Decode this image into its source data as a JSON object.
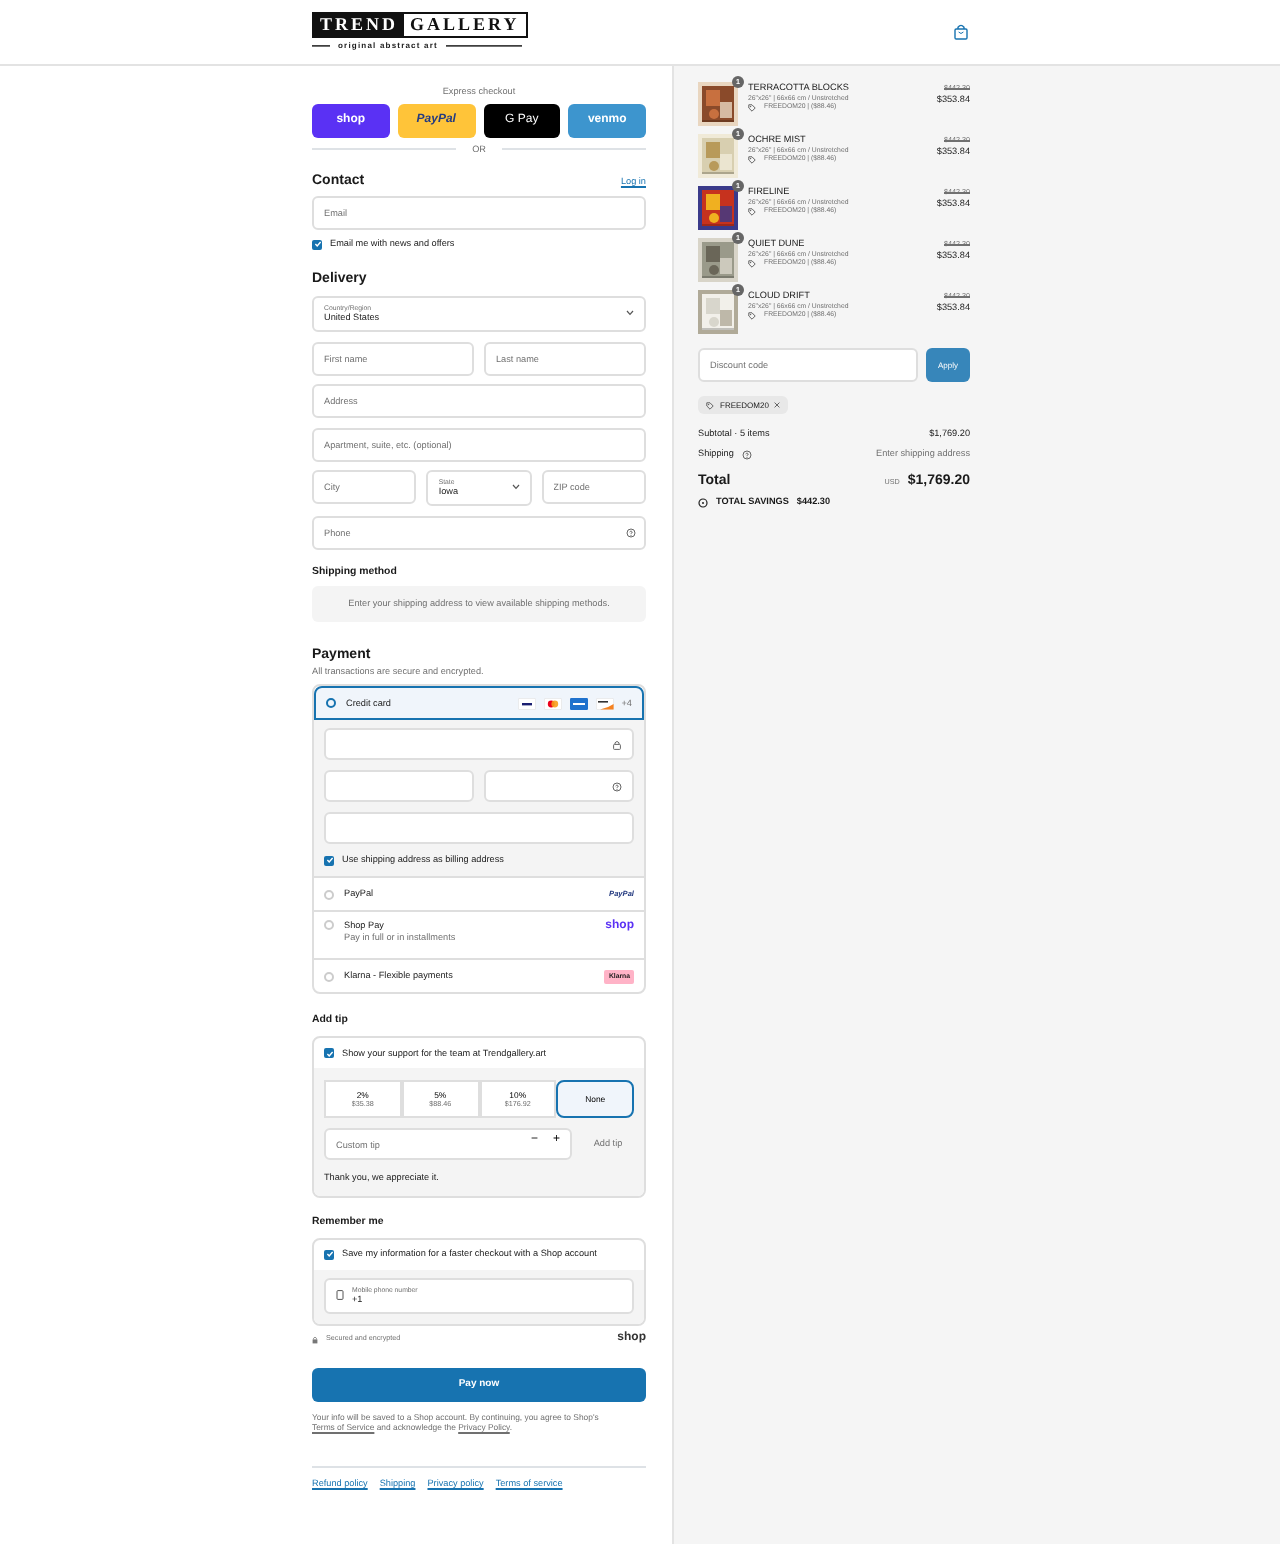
{
  "header": {
    "logo_main": "TREND",
    "logo_accent": "GALLERY",
    "tagline": "original abstract art"
  },
  "express": {
    "label": "Express checkout",
    "buttons": [
      {
        "kind": "shop",
        "label": "shop"
      },
      {
        "kind": "paypal",
        "label": "PayPal"
      },
      {
        "kind": "gpay",
        "label": "G Pay"
      },
      {
        "kind": "venmo",
        "label": "venmo"
      }
    ],
    "divider": "OR"
  },
  "contact": {
    "title": "Contact",
    "login_link": "Log in",
    "email_placeholder": "Email",
    "newsletter": {
      "label": "Email me with news and offers",
      "checked": true
    }
  },
  "delivery": {
    "title": "Delivery",
    "rows": [
      [
        {
          "kind": "select",
          "label": "Country/Region",
          "value": "United States"
        }
      ],
      [
        {
          "kind": "input",
          "placeholder": "First name"
        },
        {
          "kind": "input",
          "placeholder": "Last name"
        }
      ],
      [
        {
          "kind": "input",
          "placeholder": "Address"
        }
      ],
      [
        {
          "kind": "input",
          "placeholder": "Apartment, suite, etc. (optional)"
        }
      ],
      [
        {
          "kind": "input",
          "placeholder": "City"
        },
        {
          "kind": "select",
          "label": "State",
          "value": "Iowa"
        },
        {
          "kind": "input",
          "placeholder": "ZIP code"
        }
      ],
      [
        {
          "kind": "phone",
          "placeholder": "Phone"
        }
      ]
    ]
  },
  "shipping": {
    "title": "Shipping method",
    "notice": "Enter your shipping address to view available shipping methods."
  },
  "payment": {
    "title": "Payment",
    "note": "All transactions are secure and encrypted.",
    "methods": [
      {
        "kind": "card",
        "label": "Credit card",
        "selected": true,
        "more": "+4",
        "billing": {
          "label": "Use shipping address as billing address",
          "checked": true
        }
      },
      {
        "kind": "paypal",
        "label": "PayPal",
        "selected": false,
        "logo": "PayPal"
      },
      {
        "kind": "shoppay",
        "label": "Shop Pay",
        "sub": "Pay in full or in installments",
        "selected": false,
        "logo": "shop"
      },
      {
        "kind": "klarna",
        "label": "Klarna - Flexible payments",
        "selected": false,
        "logo": "Klarna"
      }
    ]
  },
  "tip": {
    "title": "Add tip",
    "opt_in": {
      "label": "Show your support for the team at Trendgallery.art",
      "checked": true
    },
    "options": [
      {
        "percent": "2%",
        "amount": "$35.38",
        "selected": false
      },
      {
        "percent": "5%",
        "amount": "$88.46",
        "selected": false
      },
      {
        "percent": "10%",
        "amount": "$176.92",
        "selected": false
      },
      {
        "percent": "None",
        "selected": true
      }
    ],
    "custom_placeholder": "Custom tip",
    "minus": "−",
    "plus": "+",
    "add_button": "Add tip",
    "thanks": "Thank you, we appreciate it."
  },
  "remember": {
    "title": "Remember me",
    "save": {
      "label": "Save my information for a faster checkout with a Shop account",
      "checked": true
    },
    "phone": {
      "label": "Mobile phone number",
      "value": "+1"
    },
    "secure": "Secured and encrypted",
    "brand": "shop"
  },
  "pay_button": "Pay now",
  "legal": {
    "before": "Your info will be saved to a Shop account. By continuing, you agree to Shop's ",
    "link1": "Terms of Service",
    "middle": " and acknowledge the ",
    "link2": "Privacy Policy",
    "after": "."
  },
  "footer_links": [
    "Refund policy",
    "Shipping",
    "Privacy policy",
    "Terms of service"
  ],
  "summary": {
    "items": [
      {
        "name": "TERRACOTTA BLOCKS",
        "variant": "26\"x26\" | 66x66 cm / Unstretched",
        "discount": "FREEDOM20 | ($88.46)",
        "compare_price": "$442.30",
        "price": "$353.84",
        "quantity": "1"
      },
      {
        "name": "OCHRE MIST",
        "variant": "26\"x26\" | 66x66 cm / Unstretched",
        "discount": "FREEDOM20 | ($88.46)",
        "compare_price": "$442.30",
        "price": "$353.84",
        "quantity": "1"
      },
      {
        "name": "FIRELINE",
        "variant": "26\"x26\" | 66x66 cm / Unstretched",
        "discount": "FREEDOM20 | ($88.46)",
        "compare_price": "$442.30",
        "price": "$353.84",
        "quantity": "1"
      },
      {
        "name": "QUIET DUNE",
        "variant": "26\"x26\" | 66x66 cm / Unstretched",
        "discount": "FREEDOM20 | ($88.46)",
        "compare_price": "$442.30",
        "price": "$353.84",
        "quantity": "1"
      },
      {
        "name": "CLOUD DRIFT",
        "variant": "26\"x26\" | 66x66 cm / Unstretched",
        "discount": "FREEDOM20 | ($88.46)",
        "compare_price": "$442.30",
        "price": "$353.84",
        "quantity": "1"
      }
    ],
    "discount_placeholder": "Discount code",
    "apply_button": "Apply",
    "applied_code": "FREEDOM20",
    "subtotal_label": "Subtotal · 5 items",
    "subtotal": "$1,769.20",
    "shipping_label": "Shipping",
    "shipping_value": "Enter shipping address",
    "total_label": "Total",
    "currency": "USD",
    "total": "$1,769.20",
    "savings_label": "TOTAL SAVINGS",
    "savings": "$442.30"
  }
}
